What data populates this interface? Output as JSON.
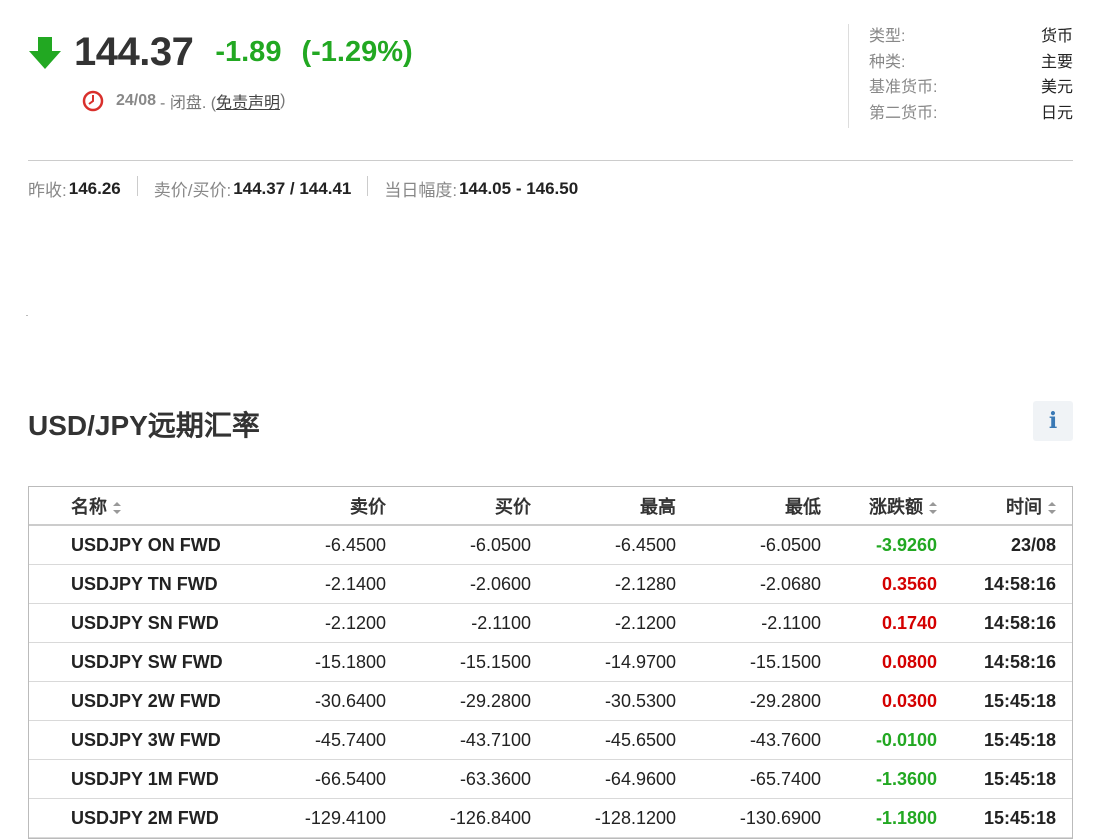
{
  "quote": {
    "price": "144.37",
    "change": "-1.89",
    "change_pct": "(-1.29%)",
    "date": "24/08",
    "status_text": " - 闭盘. (",
    "disclaimer": "免责声明",
    "status_close": ")",
    "down_color": "#22a822"
  },
  "info": [
    {
      "label": "类型:",
      "value": "货币"
    },
    {
      "label": "种类:",
      "value": "主要"
    },
    {
      "label": "基准货币:",
      "value": "美元"
    },
    {
      "label": "第二货币:",
      "value": "日元"
    }
  ],
  "stats": {
    "prev_close_label": "昨收:",
    "prev_close": "146.26",
    "bid_ask_label": "卖价/买价:",
    "bid_ask": "144.37 / 144.41",
    "day_range_label": "当日幅度:",
    "day_range": "144.05 - 146.50"
  },
  "section": {
    "title": "USD/JPY远期汇率",
    "info_icon": "i"
  },
  "table": {
    "headers": [
      "名称",
      "卖价",
      "买价",
      "最高",
      "最低",
      "涨跌额",
      "时间"
    ],
    "rows": [
      {
        "name": "USDJPY ON FWD",
        "bid": "-6.4500",
        "ask": "-6.0500",
        "high": "-6.4500",
        "low": "-6.0500",
        "chg": "-3.9260",
        "time": "23/08"
      },
      {
        "name": "USDJPY TN FWD",
        "bid": "-2.1400",
        "ask": "-2.0600",
        "high": "-2.1280",
        "low": "-2.0680",
        "chg": "0.3560",
        "time": "14:58:16"
      },
      {
        "name": "USDJPY SN FWD",
        "bid": "-2.1200",
        "ask": "-2.1100",
        "high": "-2.1200",
        "low": "-2.1100",
        "chg": "0.1740",
        "time": "14:58:16"
      },
      {
        "name": "USDJPY SW FWD",
        "bid": "-15.1800",
        "ask": "-15.1500",
        "high": "-14.9700",
        "low": "-15.1500",
        "chg": "0.0800",
        "time": "14:58:16"
      },
      {
        "name": "USDJPY 2W FWD",
        "bid": "-30.6400",
        "ask": "-29.2800",
        "high": "-30.5300",
        "low": "-29.2800",
        "chg": "0.0300",
        "time": "15:45:18"
      },
      {
        "name": "USDJPY 3W FWD",
        "bid": "-45.7400",
        "ask": "-43.7100",
        "high": "-45.6500",
        "low": "-43.7600",
        "chg": "-0.0100",
        "time": "15:45:18"
      },
      {
        "name": "USDJPY 1M FWD",
        "bid": "-66.5400",
        "ask": "-63.3600",
        "high": "-64.9600",
        "low": "-65.7400",
        "chg": "-1.3600",
        "time": "15:45:18"
      },
      {
        "name": "USDJPY 2M FWD",
        "bid": "-129.4100",
        "ask": "-126.8400",
        "high": "-128.1200",
        "low": "-130.6900",
        "chg": "-1.1800",
        "time": "15:45:18"
      }
    ]
  }
}
